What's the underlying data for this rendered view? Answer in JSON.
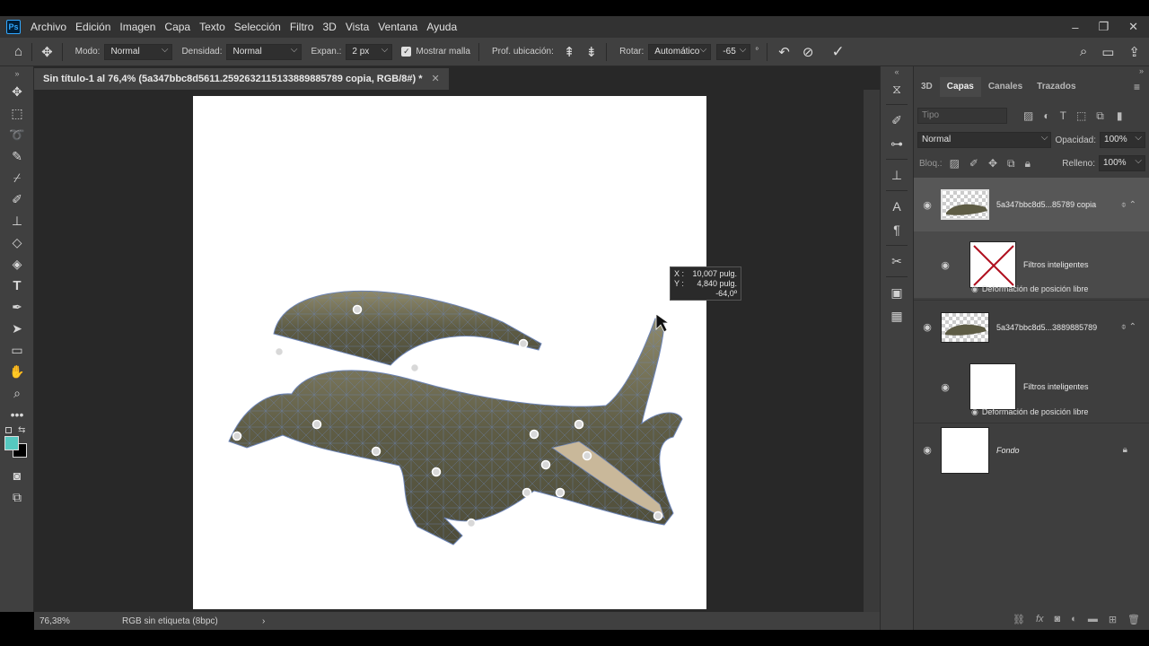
{
  "app": {
    "logo": "Ps"
  },
  "menu": [
    "Archivo",
    "Edición",
    "Imagen",
    "Capa",
    "Texto",
    "Selección",
    "Filtro",
    "3D",
    "Vista",
    "Ventana",
    "Ayuda"
  ],
  "options": {
    "modo_label": "Modo:",
    "modo_value": "Normal",
    "densidad_label": "Densidad:",
    "densidad_value": "Normal",
    "expan_label": "Expan.:",
    "expan_value": "2 px",
    "mostrar_malla": "Mostrar malla",
    "prof_label": "Prof. ubicación:",
    "rotar_label": "Rotar:",
    "rotar_value": "Automático",
    "rotar_angle": "-65",
    "degree": "°"
  },
  "document": {
    "tab_title": "Sin título-1 al 76,4% (5a347bbc8d5611.2592632115133889885789 copia, RGB/8#) *"
  },
  "tooltip": {
    "x_label": "X :",
    "x_value": "10,007 pulg.",
    "y_label": "Y :",
    "y_value": "4,840 pulg.",
    "angle": "-64,0º"
  },
  "status": {
    "zoom": "76,38%",
    "profile": "RGB sin etiqueta (8bpc)",
    "arrow": "›"
  },
  "panel": {
    "tabs": [
      "3D",
      "Capas",
      "Canales",
      "Trazados"
    ],
    "search_placeholder": "Tipo",
    "blend_mode": "Normal",
    "opacity_label": "Opacidad:",
    "opacity_value": "100%",
    "lock_label": "Bloq.:",
    "fill_label": "Relleno:",
    "fill_value": "100%",
    "layers": {
      "layer1": "5a347bbc8d5...85789 copia",
      "layer1_filters": "Filtros inteligentes",
      "layer1_filter_item": "Deformación de posición libre",
      "layer2": "5a347bbc8d5...3889885789",
      "layer2_filters": "Filtros inteligentes",
      "layer2_filter_item": "Deformación de posición libre",
      "background": "Fondo"
    }
  },
  "colors": {
    "foreground": "#56c8c0",
    "background": "#000000",
    "accent": "#31a8ff",
    "croc_dark": "#4e4d3a",
    "croc_light": "#8f8a6c",
    "mesh": "#6c84b6"
  }
}
